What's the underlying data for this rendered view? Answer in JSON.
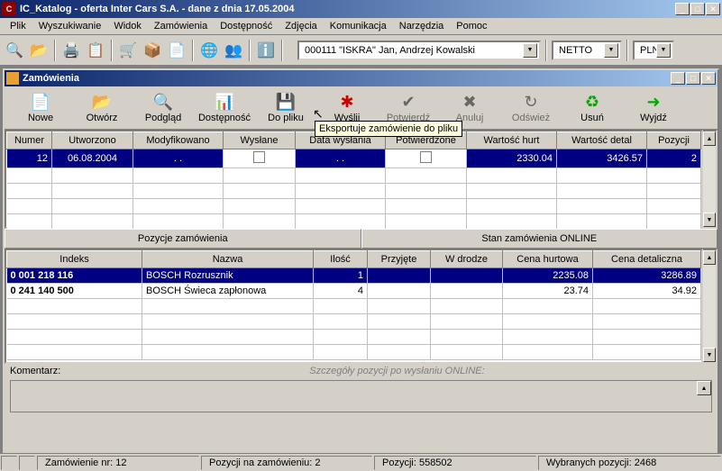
{
  "window": {
    "title": "IC_Katalog - oferta Inter Cars S.A. - dane z dnia 17.05.2004"
  },
  "menu": [
    "Plik",
    "Wyszukiwanie",
    "Widok",
    "Zamówienia",
    "Dostępność",
    "Zdjęcia",
    "Komunikacja",
    "Narzędzia",
    "Pomoc"
  ],
  "toolbar": {
    "customer": "000111 \"ISKRA\" Jan, Andrzej Kowalski",
    "price_type": "NETTO",
    "currency": "PLN"
  },
  "child": {
    "title": "Zamówienia"
  },
  "order_toolbar": {
    "nowe": "Nowe",
    "otworz": "Otwórz",
    "podglad": "Podgląd",
    "dostepnosc": "Dostępność",
    "do_pliku": "Do pliku",
    "wyslij": "Wyślij",
    "potwierdz": "Potwierdź",
    "anuluj": "Anuluj",
    "odswiez": "Odśwież",
    "usun": "Usuń",
    "wyjdz": "Wyjdź",
    "tooltip": "Eksportuje zamówienie do pliku"
  },
  "orders_grid": {
    "headers": {
      "numer": "Numer",
      "utworzono": "Utworzono",
      "modyfikowano": "Modyfikowano",
      "wyslane": "Wysłane",
      "data_wyslania": "Data wysłania",
      "potwierdzone": "Potwierdzone",
      "wartosc_hurt": "Wartość hurt",
      "wartosc_detal": "Wartość detal",
      "pozycji": "Pozycji"
    },
    "rows": [
      {
        "numer": "12",
        "utworzono": "06.08.2004",
        "modyfikowano": ". .",
        "data_wyslania": ". .",
        "wartosc_hurt": "2330.04",
        "wartosc_detal": "3426.57",
        "pozycji": "2"
      }
    ]
  },
  "tabs": {
    "pozycje": "Pozycje zamówienia",
    "stan": "Stan zamówienia ONLINE"
  },
  "items_grid": {
    "headers": {
      "indeks": "Indeks",
      "nazwa": "Nazwa",
      "ilosc": "Ilość",
      "przyjete": "Przyjęte",
      "w_drodze": "W drodze",
      "cena_hurtowa": "Cena hurtowa",
      "cena_detaliczna": "Cena detaliczna"
    },
    "rows": [
      {
        "indeks": "0 001 218 116",
        "nazwa": "BOSCH Rozrusznik",
        "ilosc": "1",
        "cena_hurtowa": "2235.08",
        "cena_detaliczna": "3286.89"
      },
      {
        "indeks": "0 241 140 500",
        "nazwa": "BOSCH Świeca zapłonowa",
        "ilosc": "4",
        "cena_hurtowa": "23.74",
        "cena_detaliczna": "34.92"
      }
    ]
  },
  "comment": {
    "label": "Komentarz:",
    "detail": "Szczegóły pozycji po wysłaniu ONLINE:"
  },
  "status": {
    "zamowienie": "Zamówienie nr: 12",
    "pozycji_na": "Pozycji na zamówieniu: 2",
    "pozycji": "Pozycji: 558502",
    "wybranych": "Wybranych pozycji: 2468"
  }
}
